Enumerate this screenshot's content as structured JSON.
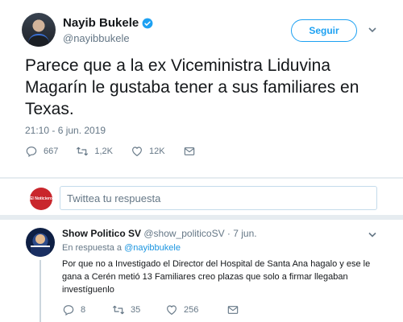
{
  "tweet": {
    "display_name": "Nayib Bukele",
    "handle": "@nayibbukele",
    "follow_label": "Seguir",
    "text": "Parece que a la ex Viceministra Liduvina Magarín le gustaba tener a sus familiares en Texas.",
    "timestamp": "21:10 - 6 jun. 2019",
    "stats": {
      "replies": "667",
      "retweets": "1,2K",
      "likes": "12K"
    }
  },
  "composer": {
    "avatar_text": "El Noticiero",
    "placeholder": "Twittea tu respuesta"
  },
  "reply": {
    "display_name": "Show Politico SV",
    "meta": "@show_politicoSV · 7 jun.",
    "in_reply_prefix": "En respuesta a",
    "in_reply_mention": "@nayibbukele",
    "text": "Por que no a Investigado el Director del Hospital de Santa Ana hagalo y ese le gana a Cerén metió 13 Familiares creo plazas que solo a firmar llegaban investíguenlo",
    "stats": {
      "replies": "8",
      "retweets": "35",
      "likes": "256"
    }
  },
  "colors": {
    "accent": "#1da1f2",
    "secondary_text": "#657786",
    "divider": "#e6ecf0"
  },
  "icons": [
    "verified-icon",
    "chevron-down-icon",
    "reply-icon",
    "retweet-icon",
    "like-icon",
    "message-icon"
  ]
}
